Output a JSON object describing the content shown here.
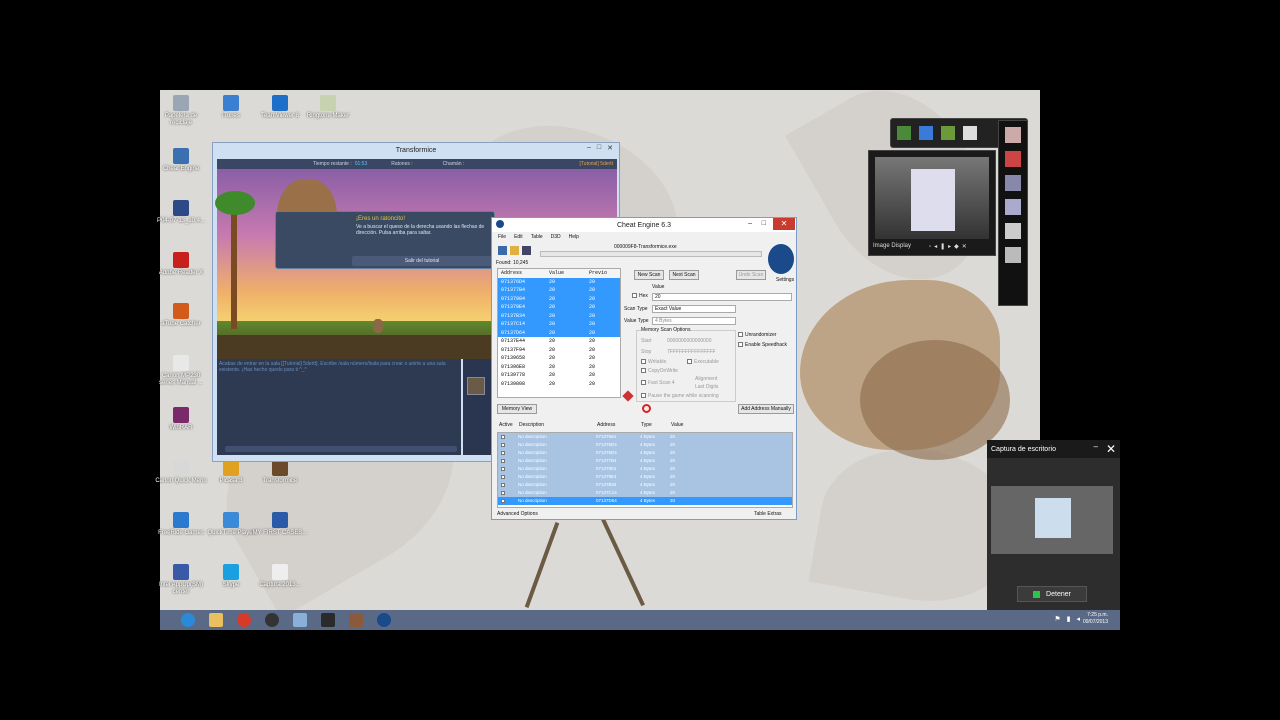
{
  "desktop_icons": [
    {
      "label": "Papelera de reciclaje",
      "color": "#9aa6b4"
    },
    {
      "label": "iTunes",
      "color": "#3a7fd0"
    },
    {
      "label": "TeamViewer 8",
      "color": "#1e6fc8"
    },
    {
      "label": "Ringtone Maker",
      "color": "#c6d2b0"
    },
    {
      "label": "Cheat Engine",
      "color": "#3a6fb0"
    },
    {
      "label": "P04-07-13_10.4...",
      "color": "#2c4a88"
    },
    {
      "label": "Adobe Reader X",
      "color": "#c8201c"
    },
    {
      "label": "aTube Catcher",
      "color": "#d25a1a"
    },
    {
      "label": "Canon MP230 series Manual ...",
      "color": "#e8e8e8"
    },
    {
      "label": "WinRAR",
      "color": "#7a2a6a"
    },
    {
      "label": "Canon Quick Menu",
      "color": "#d8d8d8"
    },
    {
      "label": "Picasa 3",
      "color": "#e0a020"
    },
    {
      "label": "Transformice",
      "color": "#6a4a2a"
    },
    {
      "label": "FreeRide Games",
      "color": "#2a7ad0"
    },
    {
      "label": "QuickTime Player",
      "color": "#3a8ad8"
    },
    {
      "label": "MY FIRST CASES...",
      "color": "#2a5aa8"
    },
    {
      "label": "Intel AppUp(SM) center",
      "color": "#3a5aa8"
    },
    {
      "label": "Skype",
      "color": "#1aa0e0"
    },
    {
      "label": "Captura 2013...",
      "color": "#eeeeee"
    }
  ],
  "transformice": {
    "title": "Transformice",
    "bar": {
      "time_label": "Tiempo restante :",
      "time_value": "01:53",
      "mice": "Ratones :",
      "shaman": "Chamán :",
      "room": "[Tutorial] 5dertt"
    },
    "dialog": {
      "heading": "¡Eres un ratoncito!",
      "body": "Ve a buscar el queso de la derecha usando las flechas de dirección. Pulsa arriba para saltar.",
      "button": "Salir del tutorial"
    },
    "chat": "Acabas de entrar en la sala [[Tutorial] 5dertt]. Escribe /sala número/lsala para crear o unirte a una sala existente. ¡Has hecho quedo para ti ^_^"
  },
  "cheat_engine": {
    "title": "Cheat Engine 6.3",
    "process": "000009F8-Transformice.exe",
    "menu": [
      "File",
      "Edit",
      "Table",
      "D3D",
      "Help"
    ],
    "found": "Found: 10,245",
    "columns": [
      "Address",
      "Value",
      "Previo"
    ],
    "scan_rows": [
      {
        "address": "071376D4",
        "value": "20",
        "prev": "20",
        "sel": true
      },
      {
        "address": "071377B4",
        "value": "20",
        "prev": "20",
        "sel": true
      },
      {
        "address": "07137904",
        "value": "20",
        "prev": "20",
        "sel": true
      },
      {
        "address": "071379E4",
        "value": "20",
        "prev": "20",
        "sel": true
      },
      {
        "address": "07137B34",
        "value": "20",
        "prev": "20",
        "sel": true
      },
      {
        "address": "07137C14",
        "value": "20",
        "prev": "20",
        "sel": true
      },
      {
        "address": "07137D64",
        "value": "20",
        "prev": "20",
        "sel": true
      },
      {
        "address": "07137E44",
        "value": "20",
        "prev": "20",
        "sel": false
      },
      {
        "address": "07137F94",
        "value": "20",
        "prev": "20",
        "sel": false
      },
      {
        "address": "07139658",
        "value": "20",
        "prev": "20",
        "sel": false
      },
      {
        "address": "071396E8",
        "value": "20",
        "prev": "20",
        "sel": false
      },
      {
        "address": "07139778",
        "value": "20",
        "prev": "20",
        "sel": false
      },
      {
        "address": "07139808",
        "value": "20",
        "prev": "20",
        "sel": false
      }
    ],
    "new_scan": "New Scan",
    "next_scan": "Next Scan",
    "undo_scan": "Undo Scan",
    "settings": "Settings",
    "value_label": "Value",
    "hex": "Hex",
    "value": "20",
    "scan_type_label": "Scan Type",
    "scan_type": "Exact Value",
    "value_type_label": "Value Type",
    "value_type": "4 Bytes",
    "mem_opts": "Memory Scan Options",
    "start": "Start",
    "start_val": "0000000000000000",
    "stop": "Stop",
    "stop_val": "7FFFFFFFFFFFFFFF",
    "writable": "Writable",
    "executable": "Executable",
    "copyonwrite": "CopyOnWrite",
    "fastscan": "Fast Scan",
    "fastscan_val": "4",
    "alignment": "Alignment",
    "lastdigits": "Last Digits",
    "pause": "Pause the game while scanning",
    "unrandomizer": "Unrandomizer",
    "speedhack": "Enable Speedhack",
    "memory_view": "Memory View",
    "add_manual": "Add Address Manually",
    "addr_columns": [
      "Active",
      "Description",
      "Address",
      "Type",
      "Value"
    ],
    "addr_rows": [
      {
        "desc": "No description",
        "address": "07137664",
        "type": "4 Bytes",
        "value": "20"
      },
      {
        "desc": "No description",
        "address": "071376D4",
        "type": "4 Bytes",
        "value": "20"
      },
      {
        "desc": "No description",
        "address": "071376D4",
        "type": "4 Bytes",
        "value": "20"
      },
      {
        "desc": "No description",
        "address": "071377B4",
        "type": "4 Bytes",
        "value": "20"
      },
      {
        "desc": "No description",
        "address": "07137904",
        "type": "4 Bytes",
        "value": "20"
      },
      {
        "desc": "No description",
        "address": "071379E4",
        "type": "4 Bytes",
        "value": "20"
      },
      {
        "desc": "No description",
        "address": "07137B34",
        "type": "4 Bytes",
        "value": "20"
      },
      {
        "desc": "No description",
        "address": "07137C14",
        "type": "4 Bytes",
        "value": "20"
      },
      {
        "desc": "No description",
        "address": "07137D64",
        "type": "4 Bytes",
        "value": "20"
      }
    ],
    "advanced": "Advanced Options",
    "extras": "Table Extras"
  },
  "image_display": {
    "label": "Image Display"
  },
  "capture": {
    "title": "Captura de escritorio",
    "stop": "Detener"
  },
  "clock": {
    "time": "7:25 p.m.",
    "date": "09/07/2013"
  }
}
